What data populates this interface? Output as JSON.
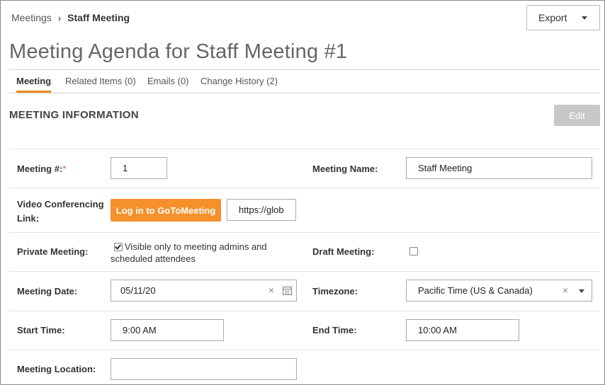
{
  "breadcrumb": {
    "parent": "Meetings",
    "separator": "›",
    "current": "Staff Meeting"
  },
  "header": {
    "export_label": "Export",
    "title": "Meeting Agenda for Staff Meeting #1"
  },
  "tabs": [
    {
      "label": "Meeting",
      "active": true
    },
    {
      "label": "Related Items (0)"
    },
    {
      "label": "Emails (0)"
    },
    {
      "label": "Change History (2)"
    }
  ],
  "section": {
    "title": "MEETING INFORMATION",
    "edit_label": "Edit"
  },
  "form": {
    "meeting_number": {
      "label": "Meeting #:",
      "required_mark": "*",
      "value": "1"
    },
    "meeting_name": {
      "label": "Meeting Name:",
      "value": "Staff Meeting"
    },
    "video_link": {
      "label_line1": "Video Conferencing",
      "label_line2": "Link:",
      "button_label": "Log in to GoToMeeting",
      "value": "https://glob"
    },
    "private_meeting": {
      "label": "Private Meeting:",
      "checked": true,
      "text_line1": "Visible only to meeting admins and",
      "text_line2": "scheduled attendees"
    },
    "draft_meeting": {
      "label": "Draft Meeting:",
      "checked": false
    },
    "meeting_date": {
      "label": "Meeting Date:",
      "value": "05/11/20",
      "clear": "×"
    },
    "timezone": {
      "label": "Timezone:",
      "value": "Pacific Time (US & Canada)",
      "clear": "×"
    },
    "start_time": {
      "label": "Start Time:",
      "value": "9:00 AM"
    },
    "end_time": {
      "label": "End Time:",
      "value": "10:00 AM"
    },
    "meeting_location": {
      "label": "Meeting Location:",
      "value": ""
    }
  },
  "colors": {
    "accent": "#f08a1c",
    "button_orange": "#f5902a",
    "disabled_button": "#c8c8c8"
  }
}
